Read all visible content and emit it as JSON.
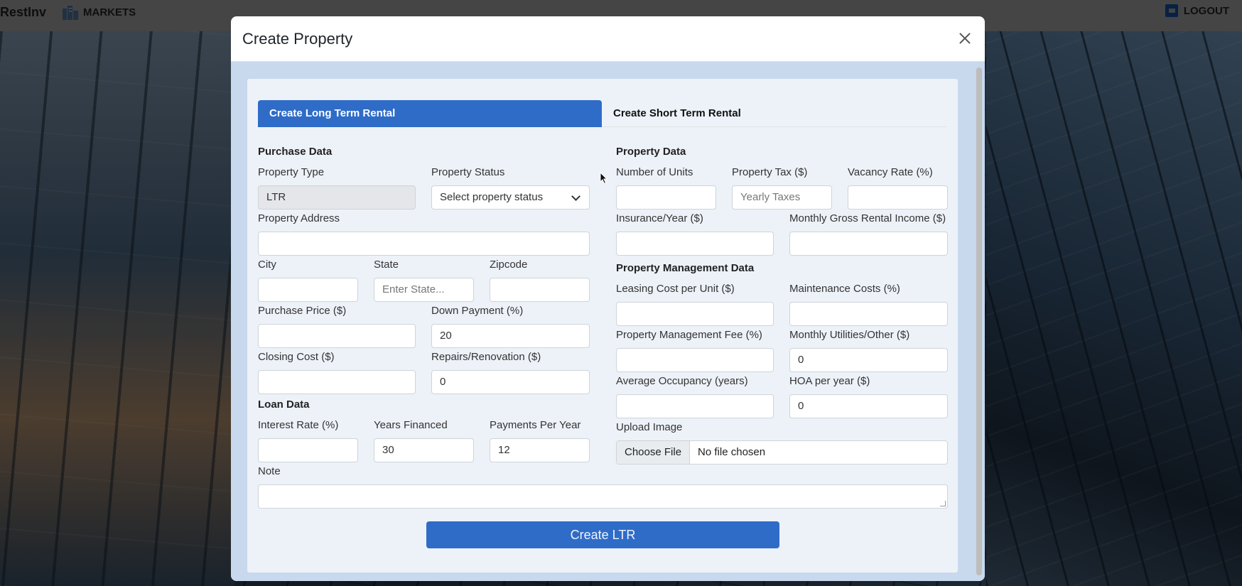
{
  "navbar": {
    "brand": "RestInv",
    "markets": "MARKETS",
    "logout": "LOGOUT"
  },
  "modal": {
    "title": "Create Property",
    "tabs": {
      "ltr": "Create Long Term Rental",
      "str": "Create Short Term Rental"
    },
    "purchase": {
      "title": "Purchase Data",
      "property_type_label": "Property Type",
      "property_type_value": "LTR",
      "property_status_label": "Property Status",
      "property_status_value": "Select property status",
      "address_label": "Property Address",
      "city_label": "City",
      "state_label": "State",
      "state_placeholder": "Enter State...",
      "zipcode_label": "Zipcode",
      "purchase_price_label": "Purchase Price ($)",
      "down_payment_label": "Down Payment (%)",
      "down_payment_value": "20",
      "closing_cost_label": "Closing Cost ($)",
      "repairs_label": "Repairs/Renovation ($)",
      "repairs_value": "0"
    },
    "loan": {
      "title": "Loan Data",
      "interest_label": "Interest Rate (%)",
      "years_label": "Years Financed",
      "years_value": "30",
      "payments_label": "Payments Per Year",
      "payments_value": "12"
    },
    "note_label": "Note",
    "property": {
      "title": "Property Data",
      "units_label": "Number of Units",
      "tax_label": "Property Tax ($)",
      "tax_placeholder": "Yearly Taxes",
      "vacancy_label": "Vacancy Rate (%)",
      "insurance_label": "Insurance/Year ($)",
      "gross_income_label": "Monthly Gross Rental Income ($)"
    },
    "management": {
      "title": "Property Management Data",
      "leasing_label": "Leasing Cost per Unit ($)",
      "maintenance_label": "Maintenance Costs (%)",
      "mgmt_fee_label": "Property Management Fee (%)",
      "utilities_label": "Monthly Utilities/Other ($)",
      "utilities_value": "0",
      "occupancy_label": "Average Occupancy (years)",
      "hoa_label": "HOA per year ($)",
      "hoa_value": "0",
      "upload_label": "Upload Image",
      "choose_file": "Choose File",
      "no_file": "No file chosen"
    },
    "submit": "Create LTR"
  },
  "colors": {
    "primary": "#2f6cc8",
    "panel": "#edf2f9",
    "modal_body": "#c8d8ed"
  }
}
